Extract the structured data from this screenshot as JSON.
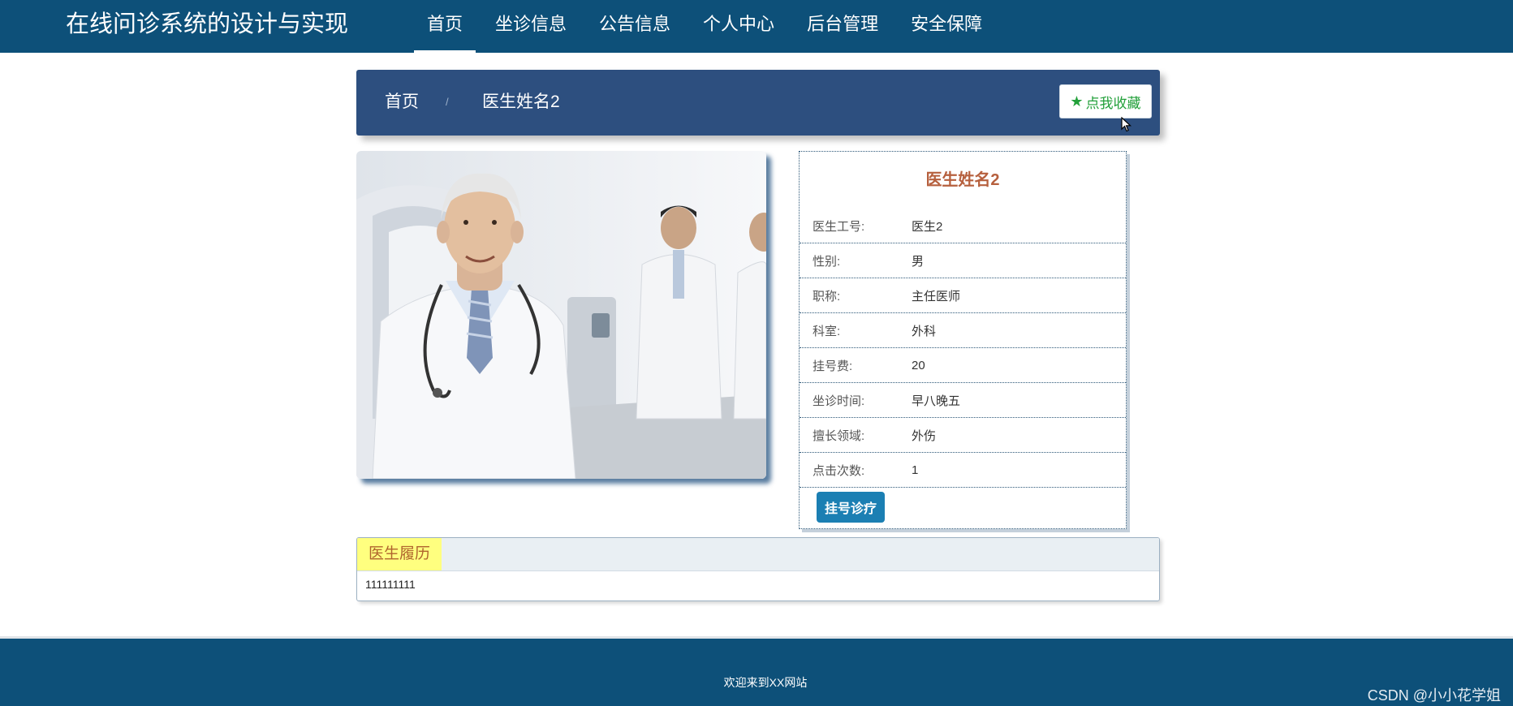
{
  "site": {
    "title": "在线问诊系统的设计与实现"
  },
  "nav": {
    "items": [
      "首页",
      "坐诊信息",
      "公告信息",
      "个人中心",
      "后台管理",
      "安全保障"
    ],
    "active_index": 0
  },
  "breadcrumb": {
    "home": "首页",
    "separator": "/",
    "current": "医生姓名2"
  },
  "favorite_button": {
    "label": "点我收藏",
    "icon": "star-icon"
  },
  "doctor": {
    "name": "医生姓名2",
    "fields": [
      {
        "label": "医生工号:",
        "value": "医生2"
      },
      {
        "label": "性别:",
        "value": "男"
      },
      {
        "label": "职称:",
        "value": "主任医师"
      },
      {
        "label": "科室:",
        "value": "外科"
      },
      {
        "label": "挂号费:",
        "value": "20"
      },
      {
        "label": "坐诊时间:",
        "value": "早八晚五"
      },
      {
        "label": "擅长领域:",
        "value": "外伤"
      },
      {
        "label": "点击次数:",
        "value": "1"
      }
    ],
    "book_button": "挂号诊疗"
  },
  "resume": {
    "tab": "医生履历",
    "content": "111111111"
  },
  "footer": {
    "text": "欢迎来到XX网站"
  },
  "watermark": "CSDN @小小花学姐",
  "colors": {
    "header_bg": "#0d5079",
    "breadcrumb_bg": "#2d4f7f",
    "name_color": "#b6603e",
    "button_bg": "#1b7fb3",
    "favorite_color": "#22a03a",
    "tab_bg": "#ffff7f"
  }
}
